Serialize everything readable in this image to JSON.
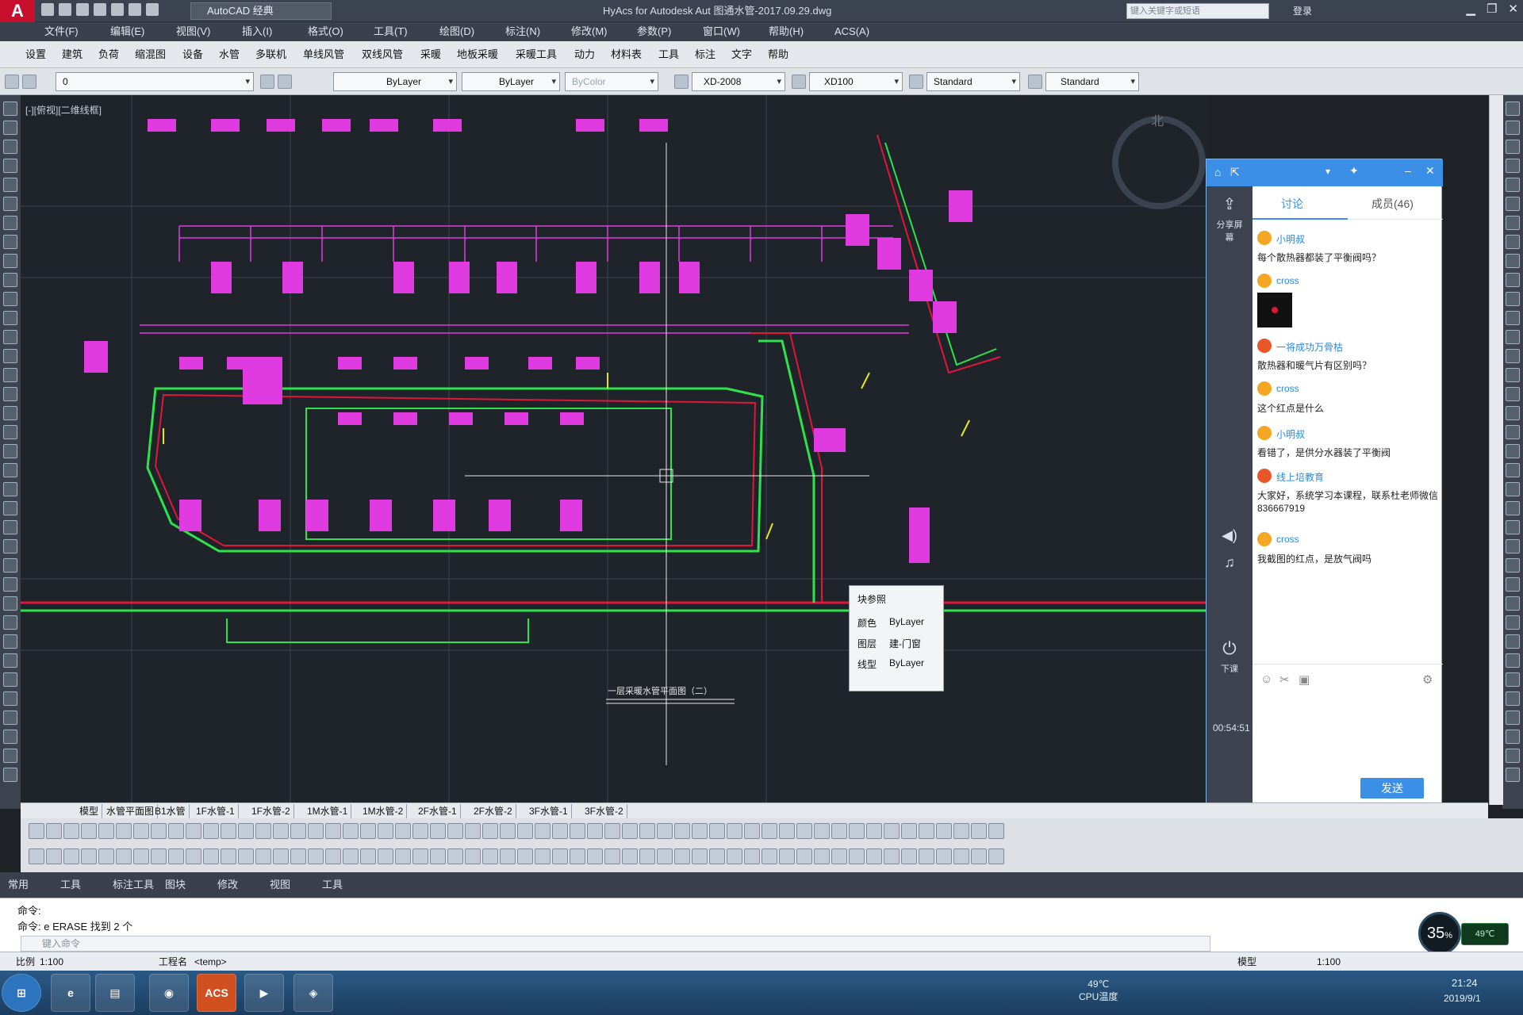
{
  "title_bar": {
    "logo": "A",
    "workspace": "AutoCAD 经典",
    "title": "HyAcs for Autodesk Aut   图通水管-2017.09.29.dwg",
    "search_placeholder": "键入关键字或短语",
    "signin": "登录"
  },
  "menu_main": [
    "文件(F)",
    "编辑(E)",
    "视图(V)",
    "插入(I)",
    "格式(O)",
    "工具(T)",
    "绘图(D)",
    "标注(N)",
    "修改(M)",
    "参数(P)",
    "窗口(W)",
    "帮助(H)",
    "ACS(A)"
  ],
  "menu_acs": [
    "设置",
    "建筑",
    "负荷",
    "缩混图",
    "设备",
    "水管",
    "多联机",
    "单线风管",
    "双线风管",
    "采暖",
    "地板采暖",
    "采暖工具",
    "动力",
    "材料表",
    "工具",
    "标注",
    "文字",
    "帮助"
  ],
  "properties": {
    "layer": "0",
    "linetype1": "ByLayer",
    "linetype2": "ByLayer",
    "color": "ByColor",
    "text_style": "XD-2008",
    "dim_style": "XD100",
    "table_style": "Standard",
    "multileader_style": "Standard"
  },
  "viewport_label": "[-][俯视][二维线框]",
  "drawing_caption": "一层采暖水管平面图（二）",
  "layout_tabs": [
    "模型",
    "水管平面图",
    "B1水管",
    "1F水管-1",
    "1F水管-2",
    "1M水管-1",
    "1M水管-2",
    "2F水管-1",
    "2F水管-2",
    "3F水管-1",
    "3F水管-2"
  ],
  "ribbon_tabs": [
    "常用",
    "工具",
    "标注工具",
    "图块",
    "修改",
    "视图",
    "工具"
  ],
  "command": {
    "history1": "命令:",
    "history2": "命令: e ERASE 找到 2 个",
    "input_placeholder": "键入命令"
  },
  "status": {
    "scale_label": "比例",
    "scale_value": "1:100",
    "project_label": "工程名",
    "project_value": "<temp>",
    "model": "模型",
    "annotation_scale": "1:100"
  },
  "tooltip": {
    "title": "块参照",
    "rows": [
      {
        "label": "颜色",
        "value": "ByLayer"
      },
      {
        "label": "图层",
        "value": "建-门窗"
      },
      {
        "label": "线型",
        "value": "ByLayer"
      }
    ]
  },
  "chat": {
    "tabs": [
      "讨论",
      "成员(46)"
    ],
    "side_share": "分享屏幕",
    "side_lower": "下课",
    "timer": "00:54:51",
    "messages": [
      {
        "name": "小明叔",
        "text": "每个散热器都装了平衡阀吗？"
      },
      {
        "name": "cross",
        "text": ""
      },
      {
        "name": "一将成功万骨枯",
        "text": "散热器和暖气片有区别吗？"
      },
      {
        "name": "cross",
        "text": "这个红点是什么"
      },
      {
        "name": "小明叔",
        "text": "看错了，是供分水器装了平衡阀"
      },
      {
        "name": "线上培教育",
        "text": "大家好，系统学习本课程，联系杜老师微信 836667919"
      },
      {
        "name": "cross",
        "text": "我截图的红点，是放气阀吗"
      }
    ],
    "send": "发送"
  },
  "perf": {
    "cpu": "35",
    "temp": "49℃"
  },
  "taskbar": {
    "apps": [
      "Start",
      "IE",
      "Explorer",
      "App",
      "ACS",
      "App2",
      "App3"
    ],
    "tray_temp": "49℃\nCPU温度",
    "clock": "21:24",
    "date": "2019/9/1"
  },
  "colors": {
    "accent": "#3b8fe6",
    "pipe_green": "#2ee34a",
    "pipe_red": "#e0163a",
    "pipe_magenta": "#e03be0",
    "canvas_bg": "#1f242b",
    "yellow": "#e6e61a"
  }
}
